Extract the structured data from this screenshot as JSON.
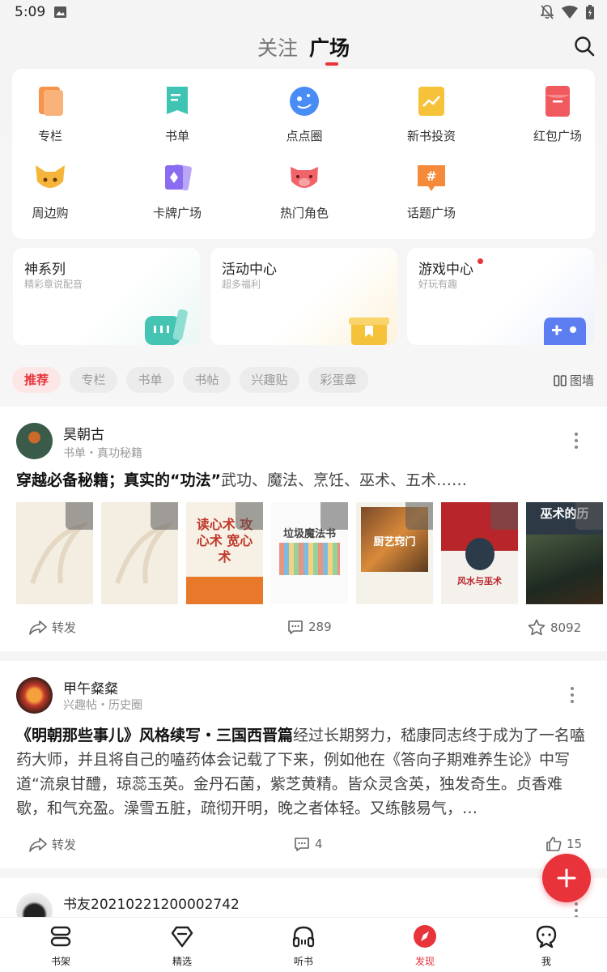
{
  "status_bar": {
    "time": "5:09"
  },
  "header": {
    "tabs": [
      "关注",
      "广场"
    ],
    "active_tab": "广场"
  },
  "menu": [
    {
      "label": "专栏",
      "icon": "column-icon",
      "color": "#f5944a"
    },
    {
      "label": "书单",
      "icon": "booklist-icon",
      "color": "#3fc4b4"
    },
    {
      "label": "点点圈",
      "icon": "circle-icon",
      "color": "#4a8cf5"
    },
    {
      "label": "新书投资",
      "icon": "invest-icon",
      "color": "#f5c23a"
    },
    {
      "label": "红包广场",
      "icon": "red-packet-icon",
      "color": "#f05a5f"
    },
    {
      "label": "周边购",
      "icon": "fox-icon",
      "color": "#f5b53a"
    },
    {
      "label": "卡牌广场",
      "icon": "card-icon",
      "color": "#8a6cf0"
    },
    {
      "label": "热门角色",
      "icon": "character-icon",
      "color": "#f0646a"
    },
    {
      "label": "话题广场",
      "icon": "topic-icon",
      "color": "#f58a3a"
    }
  ],
  "features": [
    {
      "title": "神系列",
      "subtitle": "精彩章说配音"
    },
    {
      "title": "活动中心",
      "subtitle": "超多福利"
    },
    {
      "title": "游戏中心",
      "subtitle": "好玩有趣"
    }
  ],
  "filters": [
    "推荐",
    "专栏",
    "书单",
    "书帖",
    "兴趣贴",
    "彩蛋章"
  ],
  "active_filter": "推荐",
  "wall_label": "图墙",
  "posts": [
    {
      "author": "昊朝古",
      "meta": "书单・真功秘籍",
      "title": "穿越必备秘籍；真实的“功法”",
      "body": "武功、魔法、烹饪、巫术、五术……",
      "books": [
        {
          "title": "",
          "bg": "#f3ede2",
          "fg": "#c9b99a"
        },
        {
          "title": "",
          "bg": "#f3ede2",
          "fg": "#c9b99a"
        },
        {
          "title": "读心术 攻心术 宽心术",
          "bg": "#f6f1e4",
          "fg": "#c0392b"
        },
        {
          "title": "垃圾魔法书",
          "bg": "#fafafa",
          "fg": "#444"
        },
        {
          "title": "厨艺窍门",
          "bg": "#f5f2ea",
          "fg": "#6b4226"
        },
        {
          "title": "风水与巫术",
          "bg": "#b8262b",
          "fg": "#ffffff"
        },
        {
          "title": "巫术的历",
          "bg": "#2d3a45",
          "fg": "#ffffff"
        }
      ],
      "forward": "转发",
      "comments": "289",
      "stars": "8092"
    },
    {
      "author": "甲午粲粲",
      "meta": "兴趣帖・历史圈",
      "title": "《明朝那些事儿》风格续写・三国西晋篇",
      "body": "经过长期努力，嵇康同志终于成为了一名嗑药大师，并且将自己的嗑药体会记载了下来，例如他在《答向子期难养生论》中写道“流泉甘醴，琼蕊玉英。金丹石菌，紫芝黄精。皆众灵含英，独发奇生。贞香难歇，和气充盈。澡雪五脏，疏彻开明，晚之者体轻。又练骸易气，…",
      "forward": "转发",
      "comments": "4",
      "likes": "15"
    },
    {
      "author": "书友20210221200002742"
    }
  ],
  "bottom_nav": [
    {
      "label": "书架"
    },
    {
      "label": "精选"
    },
    {
      "label": "听书"
    },
    {
      "label": "发现"
    },
    {
      "label": "我"
    }
  ],
  "active_nav": "发现",
  "colors": {
    "accent": "#e8333b",
    "background": "#f5f5f5"
  }
}
